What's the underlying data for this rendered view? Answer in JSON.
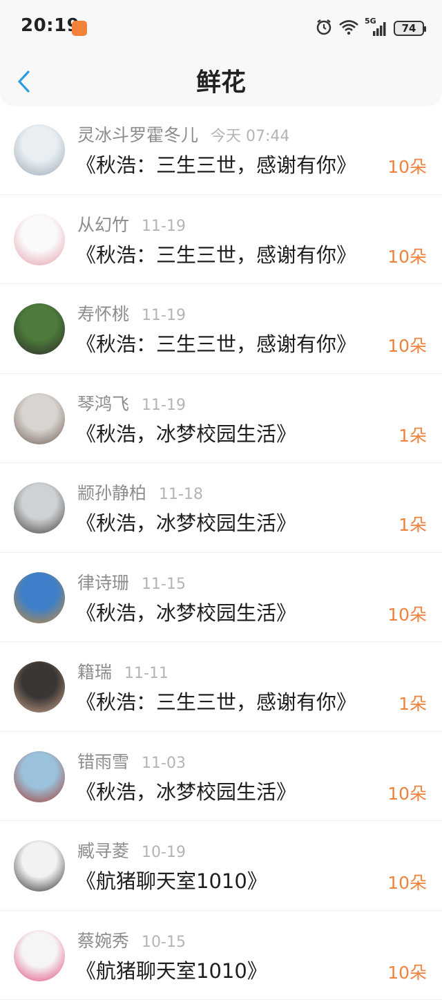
{
  "status_bar": {
    "time": "20:19",
    "battery": "74",
    "network": "5G"
  },
  "header": {
    "title": "鲜花"
  },
  "colors": {
    "accent_orange": "#f0823c",
    "back_blue": "#2a9de0"
  },
  "flowers": [
    {
      "user": "灵冰斗罗霍冬儿",
      "date": "今天 07:44",
      "work": "《秋浩：三生三世，感谢有你》",
      "count": "10朵",
      "avatar_bg": [
        "#e8eef2",
        "#9aa7b5"
      ]
    },
    {
      "user": "从幻竹",
      "date": "11-19",
      "work": "《秋浩：三生三世，感谢有你》",
      "count": "10朵",
      "avatar_bg": [
        "#fafafa",
        "#e49aa7"
      ]
    },
    {
      "user": "寿怀桃",
      "date": "11-19",
      "work": "《秋浩：三生三世，感谢有你》",
      "count": "10朵",
      "avatar_bg": [
        "#4d7b3b",
        "#2a2a2a"
      ]
    },
    {
      "user": "琴鸿飞",
      "date": "11-19",
      "work": "《秋浩，冰梦校园生活》",
      "count": "1朵",
      "avatar_bg": [
        "#d8d4cf",
        "#6e5b52"
      ]
    },
    {
      "user": "颛孙静柏",
      "date": "11-18",
      "work": "《秋浩，冰梦校园生活》",
      "count": "1朵",
      "avatar_bg": [
        "#cfd2d4",
        "#3c3c3c"
      ]
    },
    {
      "user": "律诗珊",
      "date": "11-15",
      "work": "《秋浩，冰梦校园生活》",
      "count": "10朵",
      "avatar_bg": [
        "#3d7fc9",
        "#c88a34"
      ]
    },
    {
      "user": "籍瑞",
      "date": "11-11",
      "work": "《秋浩：三生三世，感谢有你》",
      "count": "1朵",
      "avatar_bg": [
        "#3a3634",
        "#c9a48a"
      ]
    },
    {
      "user": "错雨雪",
      "date": "11-03",
      "work": "《秋浩，冰梦校园生活》",
      "count": "10朵",
      "avatar_bg": [
        "#9bc2dc",
        "#a53a2c"
      ]
    },
    {
      "user": "臧寻菱",
      "date": "10-19",
      "work": "《航猪聊天室1010》",
      "count": "10朵",
      "avatar_bg": [
        "#f2f2f2",
        "#2a2a2a"
      ]
    },
    {
      "user": "蔡婉秀",
      "date": "10-15",
      "work": "《航猪聊天室1010》",
      "count": "10朵",
      "avatar_bg": [
        "#f5f5f5",
        "#e0457a"
      ]
    }
  ]
}
